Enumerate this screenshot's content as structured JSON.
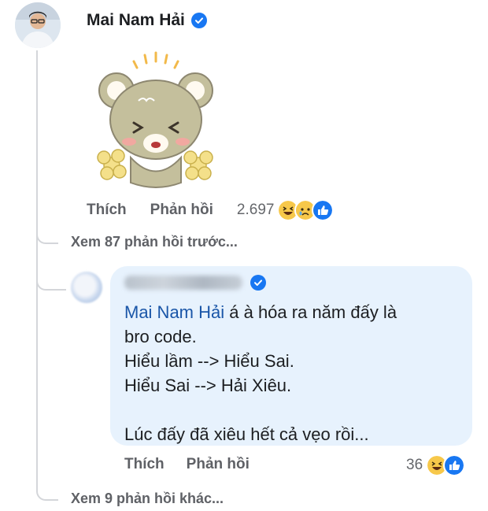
{
  "comment": {
    "author": "Mai Nam Hải",
    "verified_icon": "verified-badge-icon",
    "sticker": "bear-cheerleader-sticker",
    "actions": {
      "like": "Thích",
      "reply": "Phản hồi"
    },
    "reaction_count": "2.697",
    "reactions": [
      "haha",
      "sad",
      "like"
    ]
  },
  "previous_replies_link": "Xem 87 phản hồi trước...",
  "reply": {
    "author_blurred": true,
    "mention": "Mai Nam Hải",
    "text_line1": " á à hóa ra năm đấy là",
    "text_line2": "bro code.",
    "text_line3": "Hiểu lầm --> Hiểu Sai.",
    "text_line4": "Hiểu Sai --> Hải Xiêu.",
    "text_line5": "",
    "text_line6": "Lúc đấy đã xiêu hết cả vẹo rồi...",
    "actions": {
      "like": "Thích",
      "reply": "Phản hồi"
    },
    "reaction_count": "36",
    "reactions": [
      "haha",
      "like"
    ]
  },
  "more_replies_link": "Xem 9 phản hồi khác...",
  "colors": {
    "bubble_bg": "#e7f2fd",
    "mention": "#1a56a8",
    "verified": "#1877f2",
    "thread_line": "#d4d6da"
  }
}
